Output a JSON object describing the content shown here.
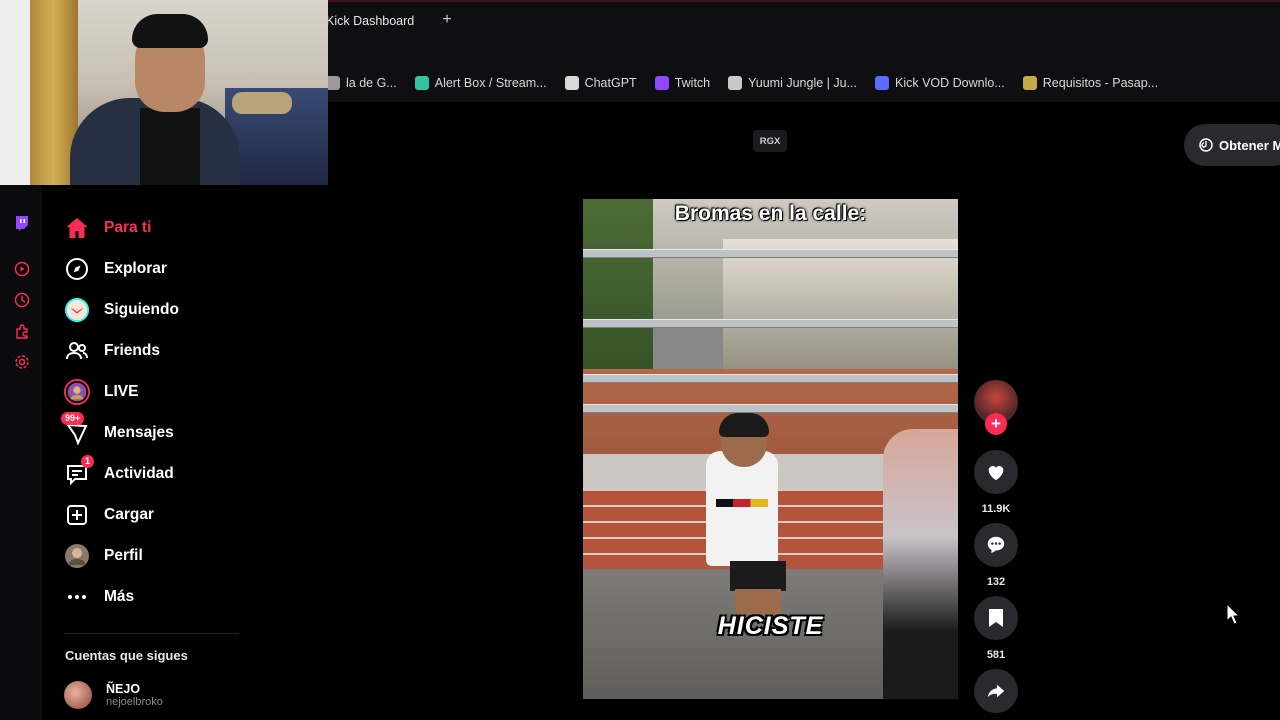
{
  "browser": {
    "active_tab": "Kick Dashboard",
    "bookmarks": [
      {
        "label": "la de G...",
        "icon": "globe-icon",
        "color": "#9a9a9a"
      },
      {
        "label": "Alert Box / Stream...",
        "icon": "streamlabs-icon",
        "color": "#31c3a2"
      },
      {
        "label": "ChatGPT",
        "icon": "chatgpt-icon",
        "color": "#d9d9d9"
      },
      {
        "label": "Twitch",
        "icon": "twitch-icon",
        "color": "#9146ff"
      },
      {
        "label": "Yuumi Jungle | Ju...",
        "icon": "yuumi-icon",
        "color": "#c9c9c9"
      },
      {
        "label": "Kick VOD Downlo...",
        "icon": "kick-vod-icon",
        "color": "#5b6bff"
      },
      {
        "label": "Requisitos - Pasap...",
        "icon": "passport-icon",
        "color": "#c9a84a"
      }
    ]
  },
  "sidebar": {
    "items": [
      {
        "label": "Para ti",
        "icon": "home-icon",
        "active": true
      },
      {
        "label": "Explorar",
        "icon": "compass-icon"
      },
      {
        "label": "Siguiendo",
        "icon": "following-icon"
      },
      {
        "label": "Friends",
        "icon": "friends-icon"
      },
      {
        "label": "LIVE",
        "icon": "live-icon"
      },
      {
        "label": "Mensajes",
        "icon": "messages-icon",
        "badge": "99+"
      },
      {
        "label": "Actividad",
        "icon": "activity-icon",
        "badge": "1"
      },
      {
        "label": "Cargar",
        "icon": "upload-icon"
      },
      {
        "label": "Perfil",
        "icon": "profile-icon"
      },
      {
        "label": "Más",
        "icon": "more-icon"
      }
    ],
    "section_title": "Cuentas que sigues",
    "following": [
      {
        "name": "ÑEJO",
        "handle": "nejoelbroko"
      }
    ]
  },
  "header": {
    "rgx_label": "RGX",
    "obtener_label": "Obtener M"
  },
  "video": {
    "title": "Bromas en la calle:",
    "caption": "HICISTE",
    "likes": "11.9K",
    "comments": "132",
    "saves": "581"
  },
  "colors": {
    "accent": "#fe2c55",
    "background": "#000000",
    "action_button": "#2a2a2e"
  }
}
